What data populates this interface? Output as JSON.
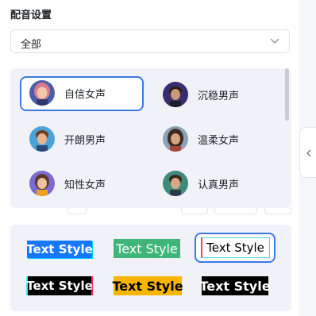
{
  "header": {
    "title": "配音设置"
  },
  "filter": {
    "selected": "全部",
    "chevron_icon": "chevron-down-icon"
  },
  "voices": [
    {
      "label": "自信女声",
      "selected": true,
      "avatar": "avatar-female-pink-hair"
    },
    {
      "label": "沉稳男声",
      "selected": false,
      "avatar": "avatar-male-dark-hair"
    },
    {
      "label": "开朗男声",
      "selected": false,
      "avatar": "avatar-male-brown-hair"
    },
    {
      "label": "温柔女声",
      "selected": false,
      "avatar": "avatar-female-dark-hair"
    },
    {
      "label": "知性女声",
      "selected": false,
      "avatar": "avatar-female-purple"
    },
    {
      "label": "认真男声",
      "selected": false,
      "avatar": "avatar-male-green"
    }
  ],
  "text_styles": [
    {
      "label": "Text Style",
      "selected": false,
      "bg": "#1677ff",
      "color": "#ffffff"
    },
    {
      "label": "Text Style",
      "selected": false,
      "bg": "#3fb57a",
      "color": "#ffffff"
    },
    {
      "label": "Text Style",
      "selected": true,
      "bg": "#ffffff",
      "color": "#000000"
    },
    {
      "label": "Text Style",
      "selected": false,
      "bg": "#000000",
      "color": "#ffffff"
    },
    {
      "label": "Text Style",
      "selected": false,
      "bg": "#f7b500",
      "color": "#000000"
    },
    {
      "label": "Text Style",
      "selected": false,
      "bg": "#000000",
      "color": "#ffffff"
    }
  ],
  "colors": {
    "accent": "#3b78e7",
    "panel_bg": "#f0f2f7"
  },
  "collapse_icon": "chevron-left-icon"
}
